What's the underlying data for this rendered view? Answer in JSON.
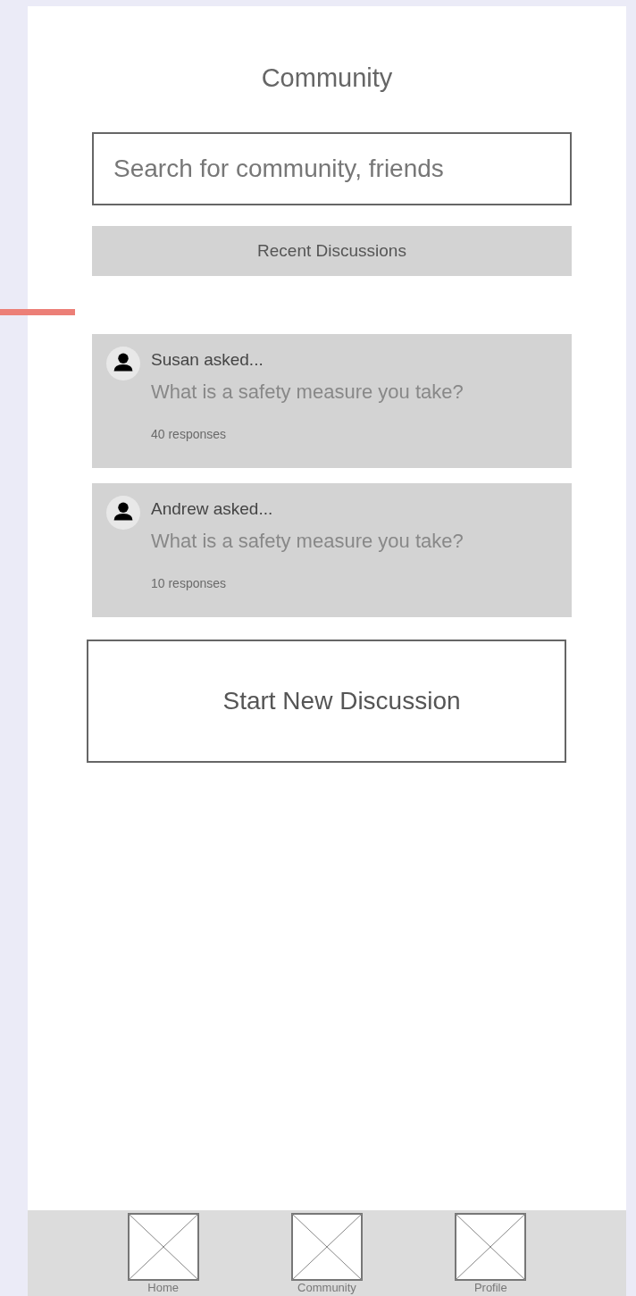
{
  "header": {
    "title": "Community"
  },
  "search": {
    "placeholder": "Search for community, friends"
  },
  "section_label": "Recent Discussions",
  "discussions": [
    {
      "author": "Susan asked...",
      "question": "What is a safety measure you take?",
      "responses": "40 responses"
    },
    {
      "author": "Andrew asked...",
      "question": "What is a safety measure you take?",
      "responses": "10 responses"
    }
  ],
  "start_button": "Start New Discussion",
  "bottom_nav": [
    {
      "label": "Home"
    },
    {
      "label": "Community"
    },
    {
      "label": "Profile"
    }
  ]
}
